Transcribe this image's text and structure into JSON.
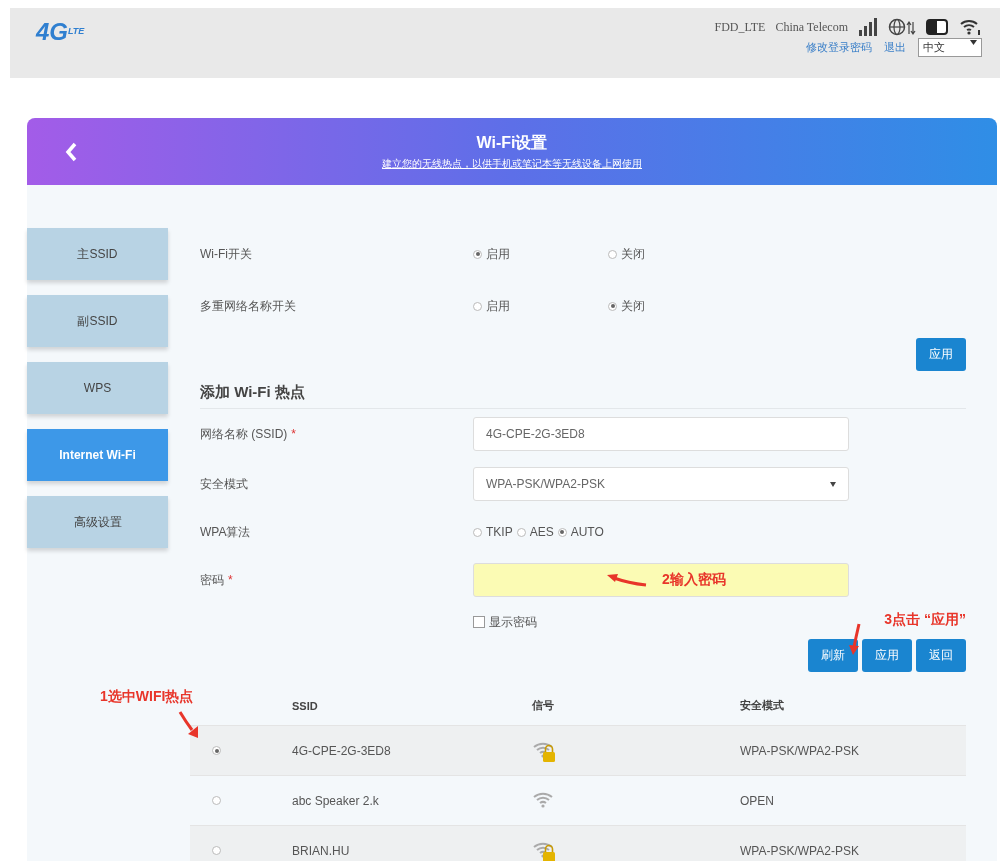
{
  "header": {
    "logo": "4G",
    "logo_sub": "LTE",
    "network_type": "FDD_LTE",
    "carrier": "China Telecom",
    "links": [
      "修改登录密码",
      "退出"
    ],
    "language": "中文"
  },
  "card": {
    "title": "Wi-Fi设置",
    "subtitle": "建立您的无线热点，以供手机或笔记本等无线设备上网使用"
  },
  "sidebar": {
    "items": [
      {
        "label": "主SSID",
        "selected": false
      },
      {
        "label": "副SSID",
        "selected": false
      },
      {
        "label": "WPS",
        "selected": false
      },
      {
        "label": "Internet Wi-Fi",
        "selected": true
      },
      {
        "label": "高级设置",
        "selected": false
      }
    ]
  },
  "switches": [
    {
      "label": "Wi-Fi开关",
      "options": [
        {
          "label": "启用",
          "selected": true
        },
        {
          "label": "关闭",
          "selected": false
        }
      ]
    },
    {
      "label": "多重网络名称开关",
      "options": [
        {
          "label": "启用",
          "selected": false
        },
        {
          "label": "关闭",
          "selected": true
        }
      ]
    }
  ],
  "switch_apply": "应用",
  "section_title": "添加 Wi-Fi 热点",
  "fields": [
    {
      "kind": "text",
      "label": "网络名称 (SSID)",
      "mark": "*",
      "value": "4G-CPE-2G-3ED8"
    },
    {
      "kind": "select",
      "label": "安全模式",
      "value": "WPA-PSK/WPA2-PSK"
    },
    {
      "kind": "radios",
      "label": "WPA算法",
      "options": [
        {
          "label": "TKIP",
          "selected": false
        },
        {
          "label": "AES",
          "selected": false
        },
        {
          "label": "AUTO",
          "selected": true
        }
      ]
    },
    {
      "kind": "password",
      "label": "密码",
      "mark": "*",
      "highlighted": true,
      "annotation": "2输入密码"
    }
  ],
  "show_password": {
    "label": "显示密码",
    "checked": false
  },
  "actions": [
    "刷新",
    "应用",
    "返回"
  ],
  "actions_annotation": "3点击 “应用”",
  "table": {
    "annotation": "1选中WIFI热点",
    "columns": [
      "SSID",
      "信号",
      "安全模式"
    ],
    "rows": [
      {
        "selected": true,
        "ssid": "4G-CPE-2G-3ED8",
        "locked": true,
        "security": "WPA-PSK/WPA2-PSK"
      },
      {
        "selected": false,
        "ssid": "abc Speaker 2.k",
        "locked": false,
        "security": "OPEN"
      },
      {
        "selected": false,
        "ssid": "BRIAN.HU",
        "locked": true,
        "security": "WPA-PSK/WPA2-PSK"
      }
    ]
  }
}
